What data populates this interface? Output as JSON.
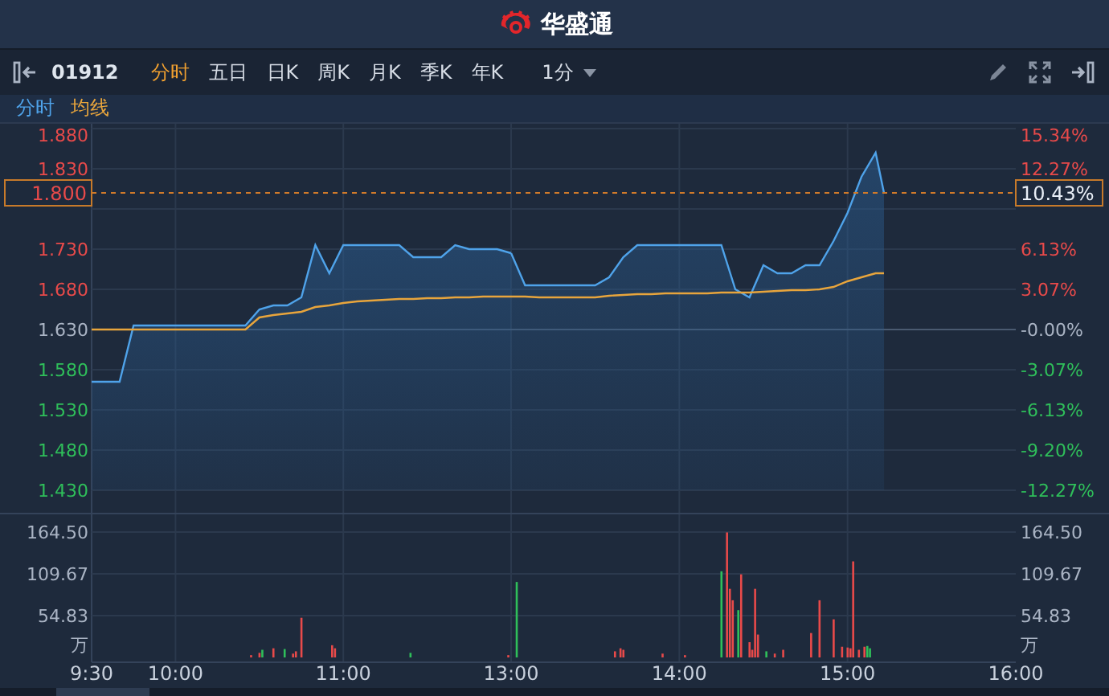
{
  "header": {
    "app_name": "华盛通"
  },
  "toolbar": {
    "symbol": "01912",
    "periods": [
      {
        "label": "分时",
        "selected": true
      },
      {
        "label": "五日",
        "selected": false
      },
      {
        "label": "日K",
        "selected": false
      },
      {
        "label": "周K",
        "selected": false
      },
      {
        "label": "月K",
        "selected": false
      },
      {
        "label": "季K",
        "selected": false
      },
      {
        "label": "年K",
        "selected": false
      }
    ],
    "interval": {
      "label": "1分"
    }
  },
  "price_chart": {
    "morning": {
      "chart_data": {
        "type": "area",
        "grid": true,
        "xlim": [
          9.5,
          12
        ],
        "ylim": [
          1.43,
          1.88
        ],
        "ref_lines": [
          {
            "axis": "y",
            "value": 1.63
          }
        ],
        "yticks": [
          {
            "value": 1.88,
            "label": "1.880"
          },
          {
            "value": 1.83,
            "label": "1.830"
          },
          {
            "value": 1.73,
            "label": "1.730"
          },
          {
            "value": 1.68,
            "label": "1.680"
          },
          {
            "value": 1.63,
            "label": "1.630"
          },
          {
            "value": 1.58,
            "label": "1.580"
          },
          {
            "value": 1.53,
            "label": "1.530"
          },
          {
            "value": 1.48,
            "label": "1.480"
          },
          {
            "value": 1.43,
            "label": "1.430"
          }
        ],
        "x": [
          9.5,
          9.583,
          9.667,
          9.75,
          9.833,
          9.917,
          10,
          10.083,
          10.167,
          10.25,
          10.333,
          10.417,
          10.5,
          10.583,
          10.667,
          10.75,
          10.833,
          10.917,
          11,
          11.083,
          11.167,
          11.25,
          11.333,
          11.417,
          11.5,
          11.583,
          11.667,
          11.75,
          11.833,
          11.917,
          12
        ],
        "series": [
          {
            "name": "分时",
            "color": "#4fa3ea",
            "values": [
              1.565,
              1.565,
              1.565,
              1.635,
              1.635,
              1.635,
              1.635,
              1.635,
              1.635,
              1.635,
              1.635,
              1.635,
              1.655,
              1.66,
              1.66,
              1.67,
              1.735,
              1.7,
              1.735,
              1.735,
              1.735,
              1.735,
              1.735,
              1.72,
              1.72,
              1.72,
              1.735,
              1.73,
              1.73,
              1.73,
              1.725
            ]
          },
          {
            "name": "均线",
            "type": "line",
            "color": "#e8a53c",
            "values": [
              1.63,
              1.63,
              1.63,
              1.63,
              1.63,
              1.63,
              1.63,
              1.63,
              1.63,
              1.63,
              1.63,
              1.63,
              1.645,
              1.648,
              1.65,
              1.652,
              1.658,
              1.66,
              1.663,
              1.665,
              1.666,
              1.667,
              1.668,
              1.668,
              1.669,
              1.669,
              1.67,
              1.67,
              1.671,
              1.671,
              1.671
            ]
          }
        ]
      }
    },
    "afternoon": {
      "chart_data": {
        "type": "area",
        "grid": true,
        "xlim": [
          13,
          16
        ],
        "ylim": [
          1.43,
          1.88
        ],
        "ref_lines": [
          {
            "axis": "y",
            "value": 1.63
          }
        ],
        "x": [
          13,
          13.083,
          13.167,
          13.25,
          13.333,
          13.417,
          13.5,
          13.583,
          13.667,
          13.75,
          13.833,
          13.917,
          14,
          14.083,
          14.167,
          14.25,
          14.333,
          14.417,
          14.5,
          14.583,
          14.667,
          14.75,
          14.833,
          14.917,
          15,
          15.083,
          15.167,
          15.217
        ],
        "series": [
          {
            "color": "#4fa3ea",
            "values": [
              1.725,
              1.685,
              1.685,
              1.685,
              1.685,
              1.685,
              1.685,
              1.695,
              1.72,
              1.735,
              1.735,
              1.735,
              1.735,
              1.735,
              1.735,
              1.735,
              1.68,
              1.67,
              1.71,
              1.7,
              1.7,
              1.71,
              1.71,
              1.74,
              1.775,
              1.82,
              1.85,
              1.8
            ]
          },
          {
            "type": "line",
            "color": "#e8a53c",
            "values": [
              1.671,
              1.671,
              1.67,
              1.67,
              1.67,
              1.67,
              1.67,
              1.672,
              1.673,
              1.674,
              1.674,
              1.675,
              1.675,
              1.675,
              1.675,
              1.676,
              1.676,
              1.676,
              1.677,
              1.678,
              1.679,
              1.679,
              1.68,
              1.683,
              1.69,
              1.695,
              1.7,
              1.7
            ]
          }
        ]
      }
    },
    "percent_axis": [
      {
        "label": "15.34%",
        "color": "#e84a4a"
      },
      {
        "label": "12.27%",
        "color": "#e84a4a"
      },
      {
        "label": "6.13%",
        "color": "#e84a4a"
      },
      {
        "label": "3.07%",
        "color": "#e84a4a"
      },
      {
        "label": "-0.00%",
        "color": "#aab4c4"
      },
      {
        "label": "-3.07%",
        "color": "#2fbf5a"
      },
      {
        "label": "-6.13%",
        "color": "#2fbf5a"
      },
      {
        "label": "-9.20%",
        "color": "#2fbf5a"
      },
      {
        "label": "-12.27%",
        "color": "#2fbf5a"
      }
    ],
    "current_price": {
      "price": "1.800",
      "change": "10.43%"
    }
  },
  "volume_chart": {
    "morning": {
      "unit": "万",
      "chart_data": {
        "type": "bar",
        "grid": true,
        "xlim": [
          9.5,
          12
        ],
        "ylim": [
          0,
          164.5
        ],
        "yticks": [
          {
            "value": 164.5,
            "label": "164.50"
          },
          {
            "value": 109.67,
            "label": "109.67"
          },
          {
            "value": 54.83,
            "label": "54.83"
          }
        ],
        "xticks": [
          {
            "value": 9.5,
            "label": "9:30"
          },
          {
            "value": 10,
            "label": "10:00"
          },
          {
            "value": 11,
            "label": "11:00"
          }
        ],
        "x": [
          10.45,
          10.5,
          10.517,
          10.583,
          10.65,
          10.7,
          10.717,
          10.75,
          10.933,
          10.95,
          11.4,
          11.983
        ],
        "series": [
          {
            "color": "#e84a4a",
            "values": [
              3,
              6,
              null,
              12,
              null,
              5,
              8,
              52,
              16,
              12,
              null,
              3
            ]
          },
          {
            "color": "#2fbf5a",
            "values": [
              null,
              null,
              10,
              null,
              11,
              null,
              null,
              null,
              null,
              null,
              6,
              null
            ]
          }
        ]
      }
    },
    "afternoon": {
      "unit": "万",
      "chart_data": {
        "type": "bar",
        "grid": true,
        "xlim": [
          13,
          16
        ],
        "ylim": [
          0,
          164.5
        ],
        "yticks": [
          {
            "value": 164.5,
            "label": "164.50"
          },
          {
            "value": 109.67,
            "label": "109.67"
          },
          {
            "value": 54.83,
            "label": "54.83"
          }
        ],
        "xticks": [
          {
            "value": 13,
            "label": "13:00"
          },
          {
            "value": 14,
            "label": "14:00"
          },
          {
            "value": 15,
            "label": "15:00"
          },
          {
            "value": 16,
            "label": "16:00"
          }
        ],
        "x": [
          13.033,
          13.617,
          13.65,
          13.667,
          13.9,
          14.033,
          14.25,
          14.283,
          14.3,
          14.317,
          14.35,
          14.367,
          14.417,
          14.433,
          14.45,
          14.467,
          14.517,
          14.567,
          14.617,
          14.783,
          14.833,
          14.917,
          14.967,
          15,
          15.017,
          15.033,
          15.067,
          15.1,
          15.117,
          15.133
        ],
        "series": [
          {
            "color": "#e84a4a",
            "values": [
              null,
              8,
              12,
              10,
              5,
              3,
              null,
              164,
              90,
              75,
              null,
              109,
              20,
              10,
              90,
              30,
              null,
              5,
              10,
              32,
              75,
              50,
              14,
              13,
              12,
              126,
              10,
              14,
              null,
              null
            ]
          },
          {
            "color": "#2fbf5a",
            "values": [
              99,
              null,
              null,
              null,
              null,
              null,
              113,
              null,
              null,
              null,
              62,
              null,
              null,
              null,
              null,
              null,
              8,
              null,
              null,
              null,
              null,
              null,
              null,
              null,
              null,
              null,
              null,
              null,
              15,
              12
            ]
          }
        ]
      }
    }
  }
}
